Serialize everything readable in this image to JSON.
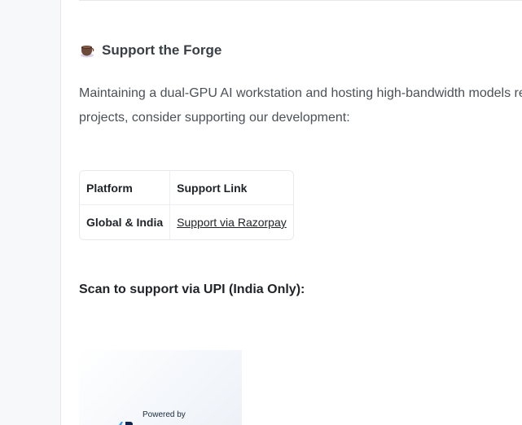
{
  "section": {
    "heading": "Support the Forge",
    "paragraph_line1": "Maintaining a dual-GPU AI workstation and hosting high-bandwidth models re",
    "paragraph_line2": "projects, consider supporting our development:"
  },
  "table": {
    "headers": [
      "Platform",
      "Support Link"
    ],
    "rows": [
      {
        "platform": "Global & India",
        "link_label": "Support via Razorpay"
      }
    ]
  },
  "scan": {
    "label": "Scan to support via UPI (India Only):",
    "powered_by": "Powered by"
  },
  "colors": {
    "gutter": "#f6f8fa",
    "text": "#24292f",
    "muted_text": "#4b5158",
    "brand_razorpay": "#3395ff"
  }
}
